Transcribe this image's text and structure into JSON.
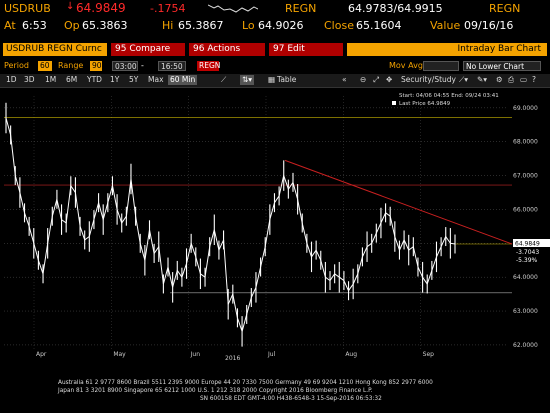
{
  "header": {
    "ticker": "USDRUB",
    "last": "64.9849",
    "change": "-.1754",
    "source1": "REGN",
    "bid_ask": "64.9783/64.9915",
    "source2": "REGN",
    "at_label": "At",
    "time": "6:53",
    "op_label": "Op",
    "open": "65.3863",
    "hi_label": "Hi",
    "high": "65.3867",
    "lo_label": "Lo",
    "low": "64.9026",
    "close_label": "Close",
    "close": "65.1604",
    "value_label": "Value",
    "value_date": "09/16/16"
  },
  "toolbar": {
    "security": "USDRUB REGN Curnc",
    "compare": "95 Compare",
    "actions": "96 Actions",
    "edit": "97 Edit",
    "title": "Intraday Bar Chart"
  },
  "settings": {
    "period_label": "Period",
    "period_value": "60",
    "range_label": "Range",
    "range_value": "90",
    "start_time": "03:00",
    "dash": "-",
    "end_time": "16:50",
    "source": "REGN",
    "mov_avg_label": "Mov Avg",
    "lower_chart": "No Lower Chart"
  },
  "tabs": [
    "1D",
    "3D",
    "1M",
    "6M",
    "YTD",
    "1Y",
    "5Y",
    "Max"
  ],
  "selected_tab": "60 Min",
  "table_label": "Table",
  "security_study": "Security/Study",
  "legend": {
    "range_text": "Start: 04/06 04:55  End: 09/24 03:41",
    "last_price": "Last Price 64.9849"
  },
  "chart_data": {
    "type": "line",
    "title": "",
    "xlabel": "",
    "ylabel": "",
    "year_label": "2016",
    "x_ticks": [
      "Apr",
      "May",
      "Jun",
      "Jul",
      "Aug",
      "Sep"
    ],
    "y_ticks": [
      "62.0000",
      "63.0000",
      "64.0000",
      "65.0000",
      "66.0000",
      "67.0000",
      "68.0000",
      "69.0000"
    ],
    "ylim": [
      61.85,
      69.35
    ],
    "right_labels": [
      "64.9849",
      "-3.7043",
      "-5.39%"
    ],
    "series": [
      {
        "name": "Last Price",
        "values": [
          68.7,
          68.2,
          67.0,
          66.5,
          65.9,
          65.5,
          65.0,
          64.5,
          64.1,
          65.0,
          65.8,
          66.3,
          65.7,
          65.6,
          66.7,
          66.5,
          65.5,
          65.1,
          65.2,
          65.7,
          66.2,
          65.7,
          66.2,
          66.7,
          66.0,
          65.6,
          65.8,
          66.9,
          65.8,
          65.0,
          64.5,
          65.4,
          64.7,
          64.9,
          63.8,
          64.3,
          63.7,
          64.2,
          64.0,
          64.4,
          65.0,
          64.6,
          64.1,
          64.0,
          64.9,
          65.4,
          64.8,
          65.1,
          63.2,
          63.5,
          62.8,
          62.4,
          62.9,
          63.4,
          63.7,
          64.3,
          64.9,
          65.7,
          66.2,
          66.4,
          67.0,
          66.6,
          66.8,
          66.3,
          65.6,
          65.0,
          64.6,
          64.8,
          64.5,
          64.0,
          63.9,
          64.1,
          64.0,
          63.9,
          63.6,
          63.8,
          64.1,
          64.6,
          64.9,
          65.0,
          65.3,
          65.6,
          65.9,
          65.8,
          65.2,
          64.8,
          65.1,
          64.8,
          64.9,
          64.3,
          64.0,
          63.8,
          64.2,
          64.6,
          64.9,
          65.2,
          65.0,
          64.98
        ]
      }
    ],
    "reference_lines": [
      68.72,
      66.72,
      64.98,
      63.54
    ],
    "trendline": [
      67.45,
      64.98
    ]
  },
  "footer": {
    "line1": "Australia 61 2 9777 8600 Brazil 5511 2395 9000 Europe 44 20 7330 7500 Germany 49 69 9204 1210 Hong Kong 852 2977 6000",
    "line2": "Japan 81 3 3201 8900          Singapore 65 6212 1000       U.S. 1 212 318 2000        Copyright 2016 Bloomberg Finance L.P.",
    "line3": "SN 600158 EDT  GMT-4:00 H438-6548-3 15-Sep-2016 06:53:32"
  },
  "colors": {
    "amber": "#f4a300",
    "red": "#ff2a2a",
    "trend": "#c82020",
    "yellow_line": "#c8b400"
  }
}
